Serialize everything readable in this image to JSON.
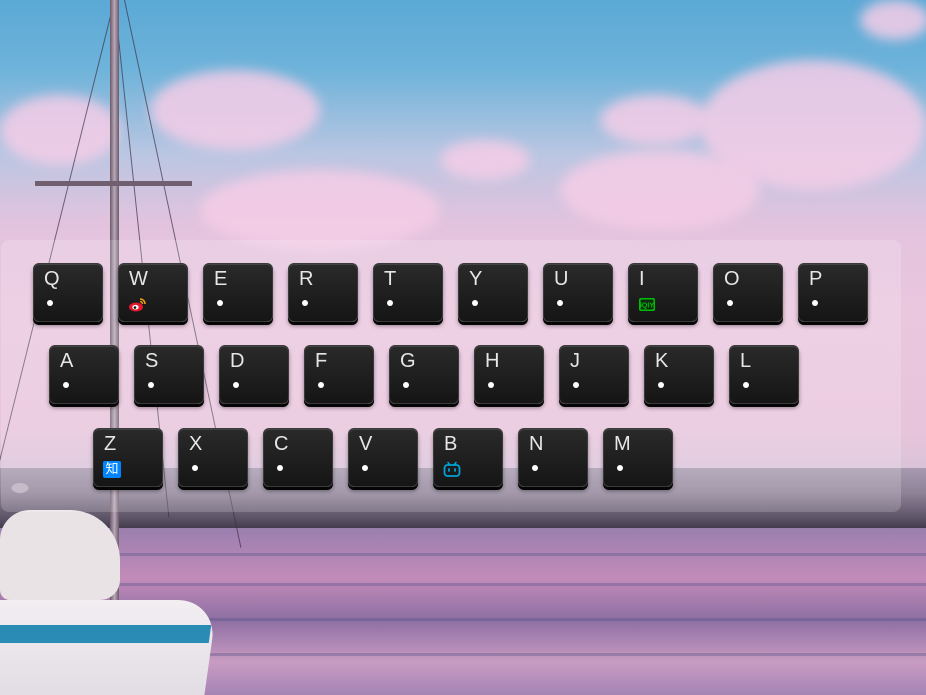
{
  "keyboard": {
    "rows": [
      [
        {
          "letter": "Q",
          "icon": null
        },
        {
          "letter": "W",
          "icon": "weibo-icon"
        },
        {
          "letter": "E",
          "icon": null
        },
        {
          "letter": "R",
          "icon": null
        },
        {
          "letter": "T",
          "icon": null
        },
        {
          "letter": "Y",
          "icon": null
        },
        {
          "letter": "U",
          "icon": null
        },
        {
          "letter": "I",
          "icon": "iqiyi-icon"
        },
        {
          "letter": "O",
          "icon": null
        },
        {
          "letter": "P",
          "icon": null
        }
      ],
      [
        {
          "letter": "A",
          "icon": null
        },
        {
          "letter": "S",
          "icon": null
        },
        {
          "letter": "D",
          "icon": null
        },
        {
          "letter": "F",
          "icon": null
        },
        {
          "letter": "G",
          "icon": null
        },
        {
          "letter": "H",
          "icon": null
        },
        {
          "letter": "J",
          "icon": null
        },
        {
          "letter": "K",
          "icon": null
        },
        {
          "letter": "L",
          "icon": null
        }
      ],
      [
        {
          "letter": "Z",
          "icon": "zhihu-icon"
        },
        {
          "letter": "X",
          "icon": null
        },
        {
          "letter": "C",
          "icon": null
        },
        {
          "letter": "V",
          "icon": null
        },
        {
          "letter": "B",
          "icon": "bilibili-icon"
        },
        {
          "letter": "N",
          "icon": null
        },
        {
          "letter": "M",
          "icon": null
        }
      ]
    ]
  },
  "icons": {
    "zhihu_label": "知"
  },
  "colors": {
    "key_background": "#1c1c1c",
    "key_letter": "#e6e6e6",
    "weibo": "#e6162d",
    "iqiyi": "#00be06",
    "zhihu": "#0084ff",
    "bilibili": "#00a1d6"
  }
}
